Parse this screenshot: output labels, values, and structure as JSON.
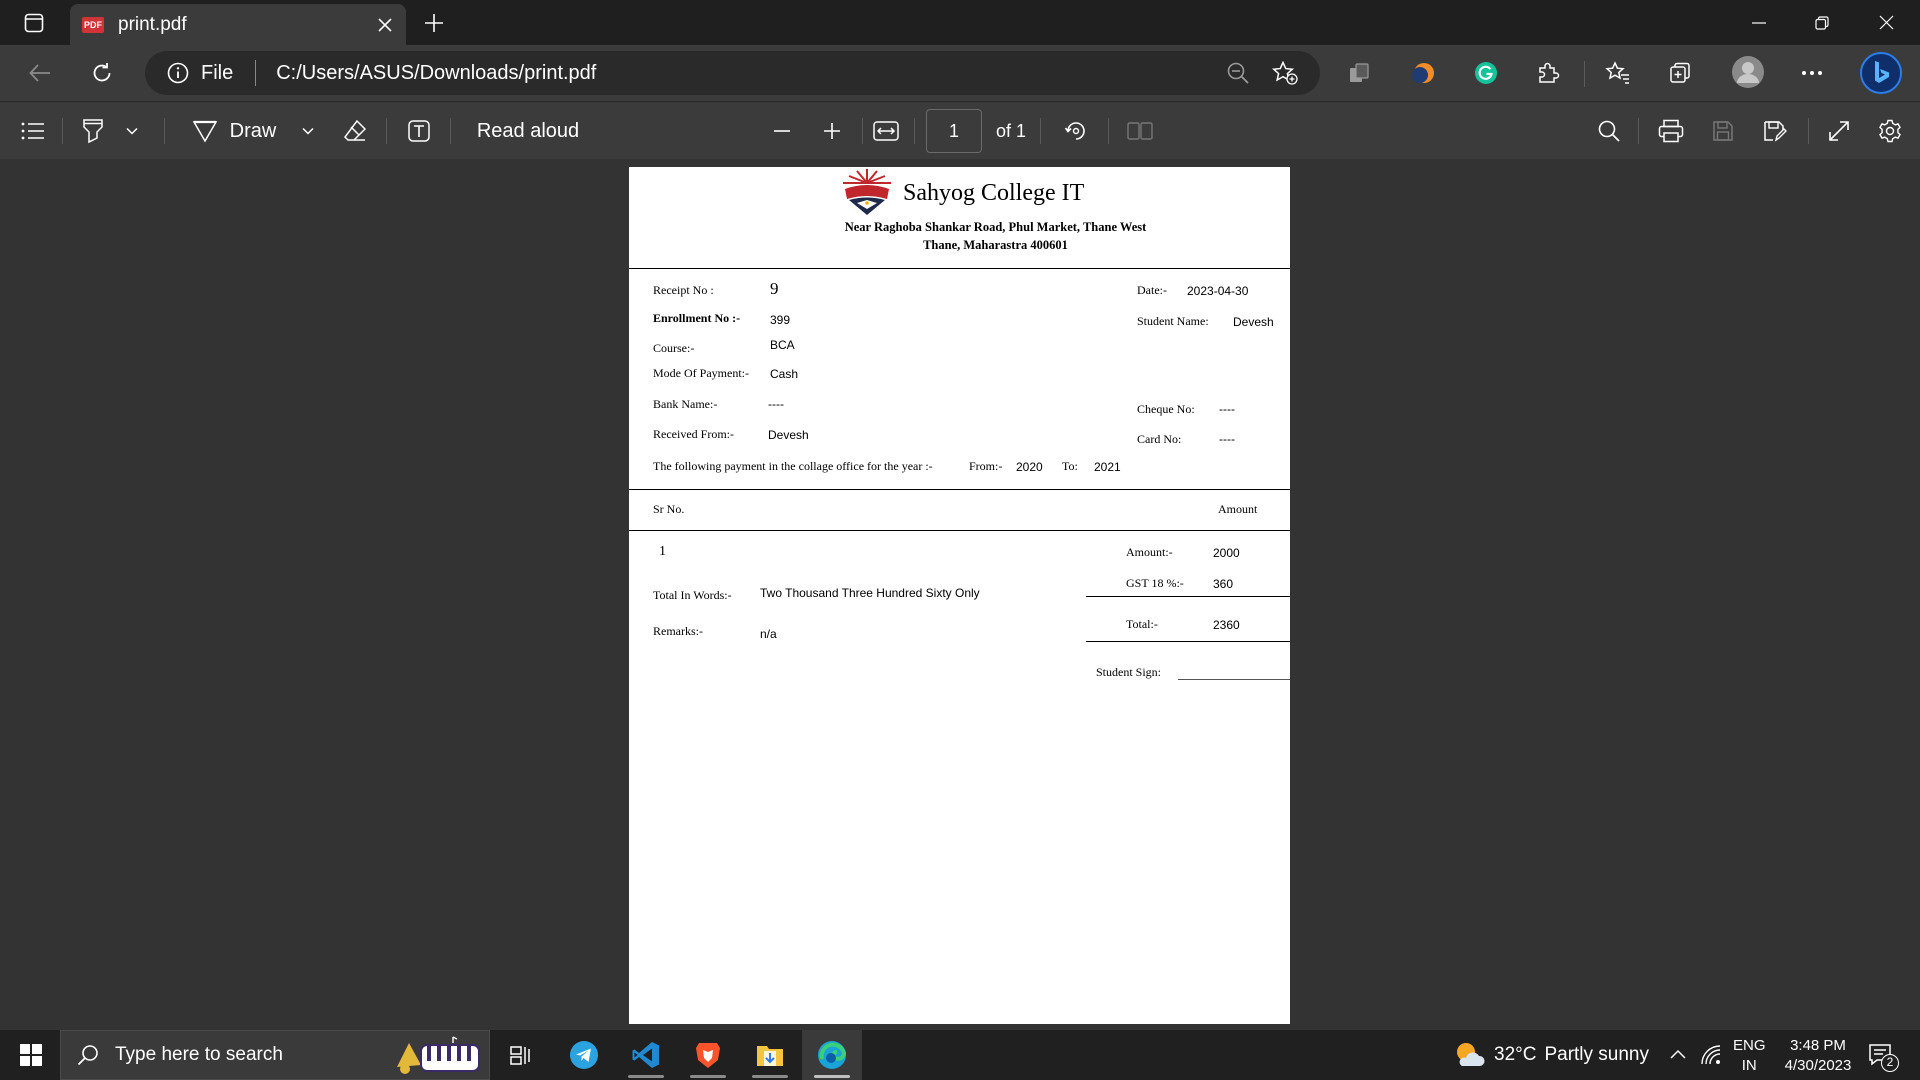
{
  "browser": {
    "tab_title": "print.pdf",
    "tab_icon_label": "PDF",
    "address": {
      "scheme_label": "File",
      "url": "C:/Users/ASUS/Downloads/print.pdf"
    }
  },
  "pdf_toolbar": {
    "draw_label": "Draw",
    "read_aloud_label": "Read aloud",
    "page_current": "1",
    "page_total": "of 1"
  },
  "receipt": {
    "college_name": "Sahyog College IT",
    "address_line1": "Near Raghoba Shankar Road, Phul Market, Thane West",
    "address_line2": "Thane, Maharastra 400601",
    "logo_text": "COLLEGE",
    "labels": {
      "receipt_no": "Receipt No :",
      "date": "Date:-",
      "enrollment_no": "Enrollment No :-",
      "student_name": "Student Name:",
      "course": "Course:-",
      "mode_of_payment": "Mode Of Payment:-",
      "bank_name": "Bank Name:-",
      "cheque_no": "Cheque No:",
      "received_from": "Received From:-",
      "card_no": "Card No:",
      "payment_text": "The following payment in the collage office for the year :-",
      "from": "From:-",
      "to": "To:",
      "sr_no": "Sr No.",
      "amount_header": "Amount",
      "amount": "Amount:-",
      "gst": "GST 18 %:-",
      "total_in_words": "Total In Words:-",
      "total": "Total:-",
      "remarks": "Remarks:-",
      "student_sign": "Student Sign:"
    },
    "values": {
      "receipt_no": "9",
      "date": "2023-04-30",
      "enrollment_no": "399",
      "student_name": "Devesh",
      "course": "BCA",
      "mode_of_payment": "Cash",
      "bank_name": "----",
      "cheque_no": "----",
      "received_from": "Devesh",
      "card_no": "----",
      "year_from": "2020",
      "year_to": "2021",
      "sr_no": "1",
      "amount": "2000",
      "gst": "360",
      "total_in_words": "Two Thousand Three Hundred Sixty Only",
      "total": "2360",
      "remarks": "n/a"
    }
  },
  "taskbar": {
    "search_placeholder": "Type here to search",
    "weather": {
      "temp": "32°C",
      "condition": "Partly sunny"
    },
    "language": {
      "line1": "ENG",
      "line2": "IN"
    },
    "clock": {
      "time": "3:48 PM",
      "date": "4/30/2023"
    },
    "notification_count": "2"
  },
  "colors": {
    "tab_bar": "#1f1f1f",
    "toolbar": "#3b3b3b",
    "viewer_bg": "#333333",
    "taskbar": "#202020",
    "pdf_red": "#d13438",
    "grammarly_green": "#15c39a",
    "bing_blue": "#1a73e8"
  }
}
